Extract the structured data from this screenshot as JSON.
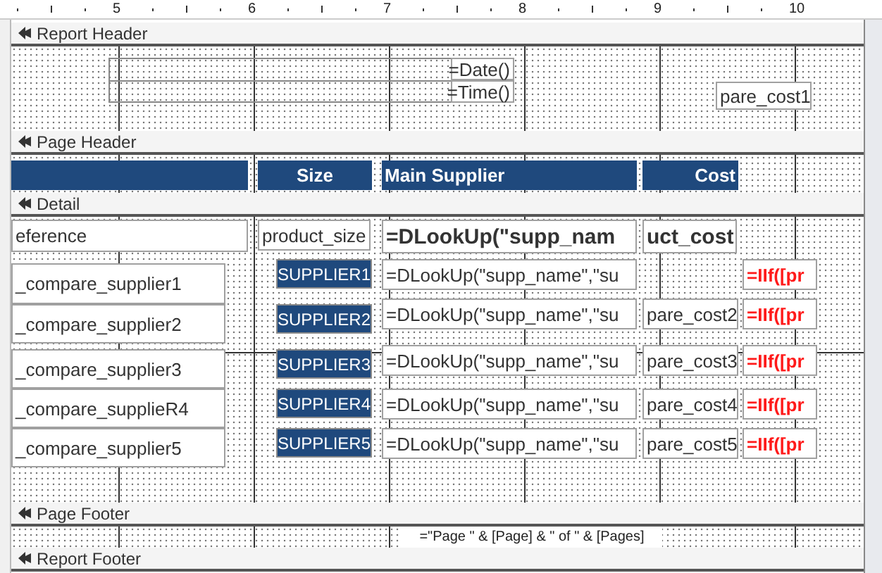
{
  "ruler": {
    "marks": [
      "5",
      "6",
      "7",
      "8",
      "9",
      "10"
    ]
  },
  "sections": [
    {
      "title": "Report Header",
      "controls": [
        {
          "kind": "textbox",
          "text": "=Date()"
        },
        {
          "kind": "textbox",
          "text": "=Time()"
        },
        {
          "kind": "textbox",
          "text": "pare_cost1"
        }
      ]
    },
    {
      "title": "Page Header",
      "controls": [
        {
          "kind": "header"
        },
        {
          "kind": "header",
          "text": "Size"
        },
        {
          "kind": "header",
          "text": "Main Supplier"
        },
        {
          "kind": "header",
          "text": "Cost"
        }
      ]
    },
    {
      "title": "Detail",
      "controls": [
        {
          "kind": "textbox",
          "text": "eference"
        },
        {
          "kind": "textbox",
          "text": "product_size"
        },
        {
          "kind": "bold",
          "text": "=DLookUp(\"supp_nam"
        },
        {
          "kind": "bold",
          "text": "uct_cost"
        },
        {
          "kind": "textbox",
          "text": "_compare_supplier1"
        },
        {
          "kind": "supplier",
          "text": "SUPPLIER1"
        },
        {
          "kind": "textbox",
          "text": "=DLookUp(\"supp_name\",\"su"
        },
        {
          "kind": "alert",
          "text": "=IIf([pr"
        },
        {
          "kind": "textbox",
          "text": "_compare_supplier2"
        },
        {
          "kind": "supplier",
          "text": "SUPPLIER2"
        },
        {
          "kind": "textbox",
          "text": "=DLookUp(\"supp_name\",\"su"
        },
        {
          "kind": "textbox",
          "text": "pare_cost2"
        },
        {
          "kind": "alert",
          "text": "=IIf([pr"
        },
        {
          "kind": "textbox",
          "text": "_compare_supplier3"
        },
        {
          "kind": "supplier",
          "text": "SUPPLIER3"
        },
        {
          "kind": "textbox",
          "text": "=DLookUp(\"supp_name\",\"su"
        },
        {
          "kind": "textbox",
          "text": "pare_cost3"
        },
        {
          "kind": "alert",
          "text": "=IIf([pr"
        },
        {
          "kind": "textbox",
          "text": "_compare_supplieR4"
        },
        {
          "kind": "supplier",
          "text": "SUPPLIER4"
        },
        {
          "kind": "textbox",
          "text": "=DLookUp(\"supp_name\",\"su"
        },
        {
          "kind": "textbox",
          "text": "pare_cost4"
        },
        {
          "kind": "alert",
          "text": "=IIf([pr"
        },
        {
          "kind": "textbox",
          "text": "_compare_supplier5"
        },
        {
          "kind": "supplier",
          "text": "SUPPLIER5"
        },
        {
          "kind": "textbox",
          "text": "=DLookUp(\"supp_name\",\"su"
        },
        {
          "kind": "textbox",
          "text": "pare_cost5"
        },
        {
          "kind": "alert",
          "text": "=IIf([pr"
        }
      ]
    },
    {
      "title": "Page Footer",
      "controls": [
        {
          "kind": "small",
          "text": "=\"Page \" & [Page] & \" of \" & [Pages]"
        }
      ]
    },
    {
      "title": "Report Footer"
    }
  ]
}
